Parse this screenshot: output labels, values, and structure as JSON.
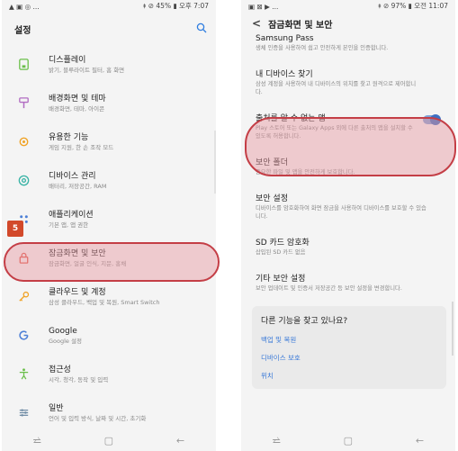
{
  "left": {
    "status": {
      "left": "▲ ▣ ◎ ...",
      "right": "⯒ ⊘ 45% ▮ 오후 7:07"
    },
    "header": {
      "title": "설정"
    },
    "items": [
      {
        "title": "디스플레이",
        "sub": "밝기, 블루라이트 필터, 홈 화면",
        "icon": "display-icon"
      },
      {
        "title": "배경화면 및 테마",
        "sub": "배경화면, 테마, 아이콘",
        "icon": "theme-icon"
      },
      {
        "title": "유용한 기능",
        "sub": "게임 지원, 한 손 조작 모드",
        "icon": "advanced-features-icon"
      },
      {
        "title": "디바이스 관리",
        "sub": "배터리, 저장공간, RAM",
        "icon": "device-care-icon"
      },
      {
        "title": "애플리케이션",
        "sub": "기본 앱, 앱 권한",
        "icon": "apps-icon"
      },
      {
        "title": "잠금화면 및 보안",
        "sub": "잠금화면, 얼굴 인식, 지문, 홍채",
        "icon": "lock-icon"
      },
      {
        "title": "클라우드 및 계정",
        "sub": "삼성 클라우드, 백업 및 복원, Smart Switch",
        "icon": "key-icon"
      },
      {
        "title": "Google",
        "sub": "Google 설정",
        "icon": "google-icon"
      },
      {
        "title": "접근성",
        "sub": "시각, 청각, 동작 및 입력",
        "icon": "accessibility-icon"
      },
      {
        "title": "일반",
        "sub": "언어 및 입력 방식, 날짜 및 시간, 초기화",
        "icon": "general-icon"
      }
    ],
    "step_badge": "5",
    "nav": {
      "recent": "⥨",
      "home": "▢",
      "back": "←"
    }
  },
  "right": {
    "status": {
      "left": "▣ ⊠ ▶ ...",
      "right": "⯒ ⊘ 97% ▮ 오전 11:07"
    },
    "header": {
      "title": "잠금화면 및 보안"
    },
    "items": [
      {
        "title": "Samsung Pass",
        "desc": "생체 인증을 사용하여 쉽고 안전하게 본인을 인증합니다."
      },
      {
        "title": "내 디바이스 찾기",
        "desc": "삼성 계정을 사용하여 내 디바이스의 위치를 찾고 원격으로 제어합니다."
      },
      {
        "title": "출처를 알 수 없는 앱",
        "desc": "Play 스토어 또는 Galaxy Apps 외에 다른 출처의 앱을 설치할 수 있도록 허용합니다."
      },
      {
        "title": "보안 폴더",
        "desc": "중요한 파일 및 앱을 안전하게 보호합니다."
      },
      {
        "title": "보안 설정",
        "desc": "디바이스를 암호화하여 화면 잠금을 사용하여 디바이스를 보호할 수 있습니다."
      },
      {
        "title": "SD 카드 암호화",
        "desc": "삽입된 SD 카드 없음"
      },
      {
        "title": "기타 보안 설정",
        "desc": "보안 업데이트 및 인증서 저장공간 등 보안 설정을 변경합니다."
      }
    ],
    "help": {
      "title": "다른 기능을 찾고 있나요?",
      "links": [
        "백업 및 복원",
        "디바이스 보호",
        "위치"
      ]
    },
    "nav": {
      "recent": "⥨",
      "home": "▢",
      "back": "←"
    }
  }
}
